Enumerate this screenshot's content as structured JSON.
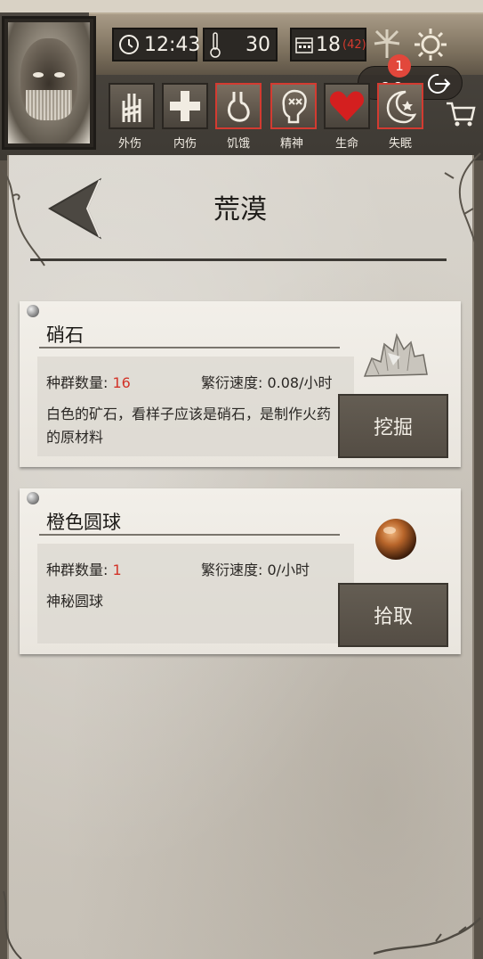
{
  "status_bar": {
    "time_text": ""
  },
  "header": {
    "clock": "12:43",
    "temperature": "30",
    "days": "18",
    "days_extra": "(42)",
    "notification_count": "1"
  },
  "status_effects": [
    {
      "label": "外伤",
      "alert": false
    },
    {
      "label": "内伤",
      "alert": false
    },
    {
      "label": "饥饿",
      "alert": true
    },
    {
      "label": "精神",
      "alert": true
    },
    {
      "label": "生命",
      "alert": false
    },
    {
      "label": "失眠",
      "alert": true
    }
  ],
  "page": {
    "title": "荒漠"
  },
  "resources": [
    {
      "name": "硝石",
      "population_label": "种群数量: ",
      "population_value": "16",
      "growth_label": "繁衍速度: 0.08/小时",
      "description": "白色的矿石，看样子应该是硝石，是制作火药的原材料",
      "action_label": "挖掘",
      "icon": "crystal-ore-icon"
    },
    {
      "name": "橙色圆球",
      "population_label": "种群数量: ",
      "population_value": "1",
      "growth_label": "繁衍速度: 0/小时",
      "description": "神秘圆球",
      "action_label": "拾取",
      "icon": "orange-orb-icon"
    }
  ],
  "colors": {
    "alert_border": "#d33b31",
    "number_red": "#d23328",
    "parchment": "#d8d4cc",
    "button": "#5d564c"
  }
}
